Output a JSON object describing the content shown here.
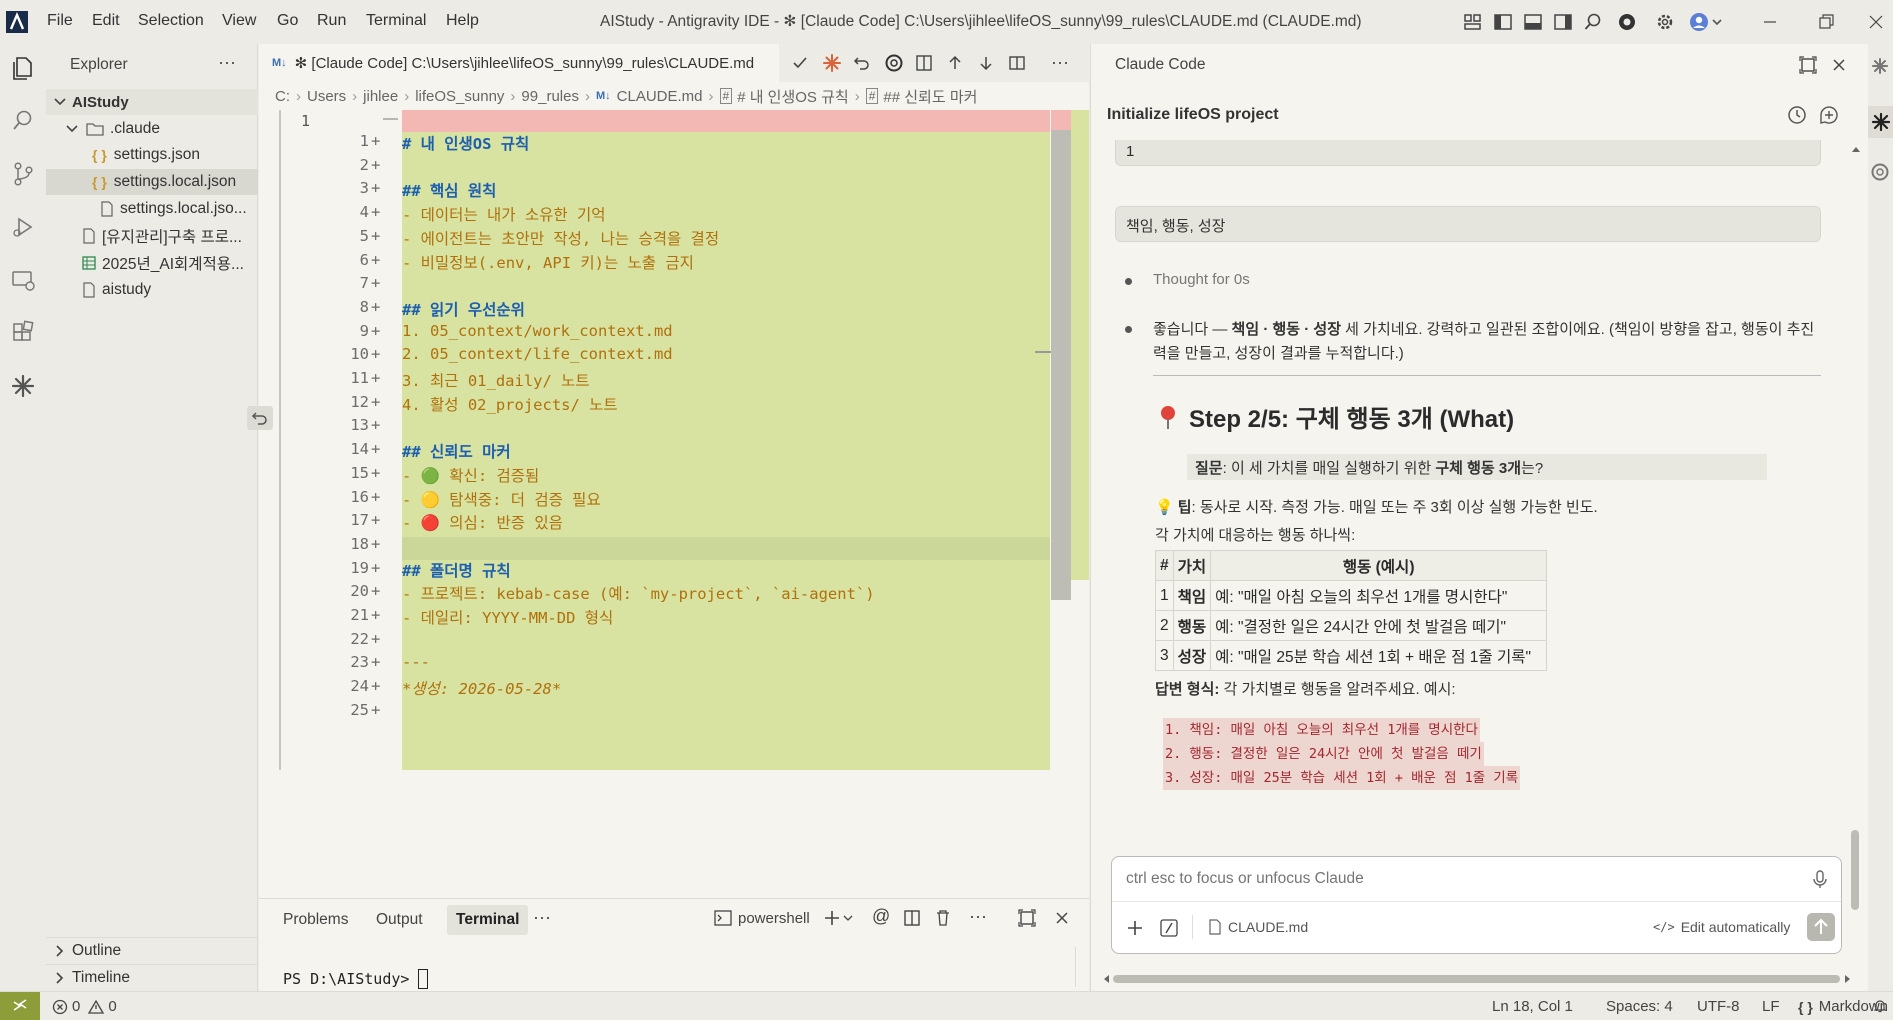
{
  "titlebar": {
    "menu": [
      "File",
      "Edit",
      "Selection",
      "View",
      "Go",
      "Run",
      "Terminal",
      "Help"
    ],
    "window_title": "AIStudy - Antigravity IDE - ✻ [Claude Code] C:\\Users\\jihlee\\lifeOS_sunny\\99_rules\\CLAUDE.md (CLAUDE.md)"
  },
  "sidebar": {
    "title": "Explorer",
    "more": "···",
    "root": "AIStudy",
    "tree": [
      {
        "label": ".claude",
        "kind": "folder"
      },
      {
        "label": "settings.json",
        "kind": "json"
      },
      {
        "label": "settings.local.json",
        "kind": "json",
        "selected": true
      },
      {
        "label": "settings.local.jso...",
        "kind": "file"
      },
      {
        "label": "[유지관리]구축 프로...",
        "kind": "file"
      },
      {
        "label": "2025년_AI회계적용...",
        "kind": "sheet"
      },
      {
        "label": "aistudy",
        "kind": "file"
      }
    ],
    "outline": "Outline",
    "timeline": "Timeline"
  },
  "editor": {
    "tab_label": "✻ [Claude Code] C:\\Users\\jihlee\\lifeOS_sunny\\99_rules\\CLAUDE.md",
    "tab_prefix": "M↓",
    "breadcrumb": [
      "C:",
      "Users",
      "jihlee",
      "lifeOS_sunny",
      "99_rules",
      "CLAUDE.md",
      "# 내 인생OS 규칙",
      "## 신뢰도 마커"
    ],
    "deleted_line_no": "1",
    "deleted_marker": "—",
    "lines": [
      {
        "n": "1",
        "text": "# 내 인생OS 규칙",
        "style": "h"
      },
      {
        "n": "2",
        "text": "",
        "style": ""
      },
      {
        "n": "3",
        "text": "## 핵심 원칙",
        "style": "h"
      },
      {
        "n": "4",
        "text": "- 데이터는 내가 소유한 기억",
        "style": "b"
      },
      {
        "n": "5",
        "text": "- 에이전트는 초안만 작성, 나는 승격을 결정",
        "style": "b"
      },
      {
        "n": "6",
        "text": "- 비밀정보(.env, API 키)는 노출 금지",
        "style": "b"
      },
      {
        "n": "7",
        "text": "",
        "style": ""
      },
      {
        "n": "8",
        "text": "## 읽기 우선순위",
        "style": "h"
      },
      {
        "n": "9",
        "text": "1. 05_context/work_context.md",
        "style": "b"
      },
      {
        "n": "10",
        "text": "2. 05_context/life_context.md",
        "style": "b"
      },
      {
        "n": "11",
        "text": "3. 최근 01_daily/ 노트",
        "style": "b"
      },
      {
        "n": "12",
        "text": "4. 활성 02_projects/ 노트",
        "style": "b"
      },
      {
        "n": "13",
        "text": "",
        "style": ""
      },
      {
        "n": "14",
        "text": "## 신뢰도 마커",
        "style": "h"
      },
      {
        "n": "15",
        "text": "- 🟢 확신: 검증됨",
        "style": "b"
      },
      {
        "n": "16",
        "text": "- 🟡 탐색중: 더 검증 필요",
        "style": "b"
      },
      {
        "n": "17",
        "text": "- 🔴 의심: 반증 있음",
        "style": "b"
      },
      {
        "n": "18",
        "text": "",
        "style": ""
      },
      {
        "n": "19",
        "text": "## 폴더명 규칙",
        "style": "h"
      },
      {
        "n": "20",
        "text": "- 프로젝트: kebab-case (예: `my-project`, `ai-agent`)",
        "style": "b"
      },
      {
        "n": "21",
        "text": "- 데일리: YYYY-MM-DD 형식",
        "style": "b"
      },
      {
        "n": "22",
        "text": "",
        "style": ""
      },
      {
        "n": "23",
        "text": "---",
        "style": "b"
      },
      {
        "n": "24",
        "text": "*생성: 2026-05-28*",
        "style": "i"
      },
      {
        "n": "25",
        "text": "",
        "style": ""
      }
    ]
  },
  "panel": {
    "tabs": [
      "Problems",
      "Output",
      "Terminal"
    ],
    "active_tab": "Terminal",
    "shell": "powershell",
    "prompt": "PS D:\\AIStudy> "
  },
  "claude": {
    "title": "Claude Code",
    "session_title": "Initialize lifeOS project",
    "answer_box_1": "1",
    "answer_box_2": "책임, 행동, 성장",
    "thought": "Thought for 0s",
    "message_pre": "좋습니다 — ",
    "message_bold": "책임 · 행동 · 성장",
    "message_post": " 세 가치네요. 강력하고 일관된 조합이에요. (책임이 방향을 잡고, 행동이 추진력을 만들고, 성장이 결과를 누적합니다.)",
    "step_heading": "Step 2/5: 구체 행동 3개 (What)",
    "question_label": "질문",
    "question_pre": ": 이 세 가치를 매일 실행하기 위한 ",
    "question_bold": "구체 행동 3개",
    "question_post": "는?",
    "tip_label": "팁",
    "tip_text": ": 동사로 시작. 측정 가능. 매일 또는 주 3회 이상 실행 가능한 빈도.",
    "mapping_text": "각 가치에 대응하는 행동 하나씩:",
    "table_headers": [
      "#",
      "가치",
      "행동 (예시)"
    ],
    "table_rows": [
      [
        "1",
        "책임",
        "예: \"매일 아침 오늘의 최우선 1개를 명시한다\""
      ],
      [
        "2",
        "행동",
        "예: \"결정한 일은 24시간 안에 첫 발걸음 떼기\""
      ],
      [
        "3",
        "성장",
        "예: \"매일 25분 학습 세션 1회 + 배운 점 1줄 기록\""
      ]
    ],
    "format_label": "답변 형식:",
    "format_text": " 각 가치별로 행동을 알려주세요. 예시:",
    "code_lines": [
      "1. 책임: 매일 아침 오늘의 최우선 1개를 명시한다",
      "2. 행동: 결정한 일은 24시간 안에 첫 발걸음 떼기",
      "3. 성장: 매일 25분 학습 세션 1회 + 배운 점 1줄 기록"
    ],
    "input_placeholder": "ctrl esc to focus or unfocus Claude",
    "attached_file": "CLAUDE.md",
    "edit_mode": "Edit automatically"
  },
  "statusbar": {
    "errors": "0",
    "warnings": "0",
    "position": "Ln 18, Col 1",
    "spaces": "Spaces: 4",
    "encoding": "UTF-8",
    "eol": "LF",
    "language": "Markdown"
  }
}
